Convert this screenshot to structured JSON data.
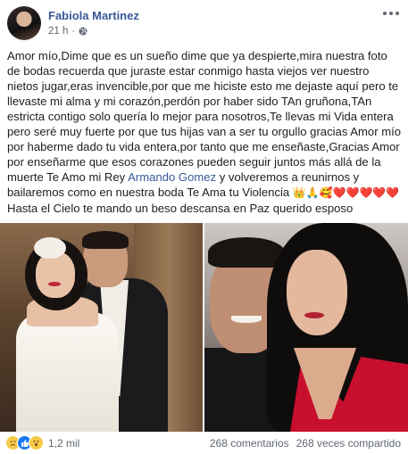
{
  "post": {
    "author": "Fabiola Martinez",
    "time": "21 h",
    "privacy_separator": "·",
    "text_part1": "Amor mío,Dime que es un sueño dime que ya despierte,mira nuestra foto de bodas recuerda que juraste estar conmigo hasta viejos ver nuestro nietos jugar,eras invencible,por que me hiciste esto me dejaste aquí pero te llevaste mi alma y mi corazón,perdón por haber sido TAn gruñona,TAn estricta contigo solo quería lo mejor para nosotros,Te llevas mi Vida entera pero seré muy fuerte por que tus hijas van a ser tu orgullo gracias Amor mío por haberme dado tu vida entera,por tanto que me enseñaste,Gracias Amor por enseñarme que esos corazones pueden seguir juntos más allá de la muerte Te Amo mi Rey ",
    "mention": "Armando Gomez",
    "text_part2": " y volveremos a reunirnos y bailaremos como en nuestra boda Te Ama tu Violencia ",
    "emojis": "👑🙏🥰❤️❤️❤️❤️❤️",
    "text_part3": " Hasta el Cielo te mando un beso descansa en Paz querido esposo"
  },
  "footer": {
    "reaction_count": "1,2 mil",
    "comments": "268 comentarios",
    "shares": "268 veces compartido",
    "reaction_icons": [
      "sad-face",
      "like-thumb",
      "wow-face"
    ]
  },
  "colors": {
    "link": "#385898",
    "meta": "#606770",
    "like_blue": "#1877f2",
    "emoji_yellow": "#f7c948",
    "dress_red": "#c8102e"
  }
}
